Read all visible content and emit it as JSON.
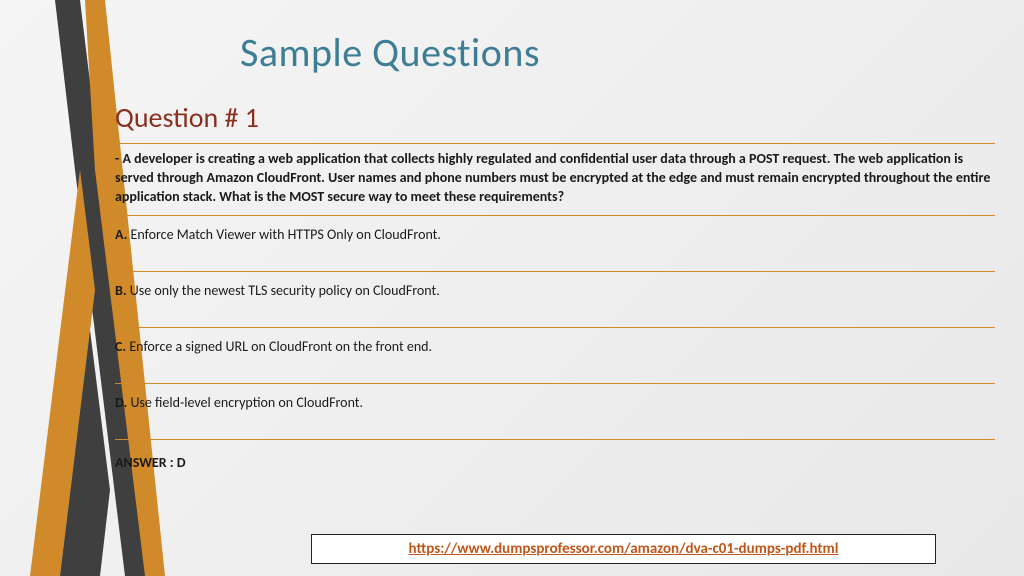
{
  "slide": {
    "title": "Sample Questions"
  },
  "question": {
    "heading": "Question # 1",
    "text": "- A developer is creating a web application that collects highly regulated and confidential user data through a POST request. The web application is served through Amazon CloudFront. User names and phone numbers must be encrypted at the edge and must remain encrypted throughout the entire application stack. What is the MOST secure way to meet these requirements?",
    "options": {
      "A": "Enforce Match Viewer with HTTPS Only on CloudFront.",
      "B": "Use only the newest TLS security policy on CloudFront.",
      "C": "Enforce a signed URL on CloudFront on the front end.",
      "D": "Use field-level encryption on CloudFront."
    },
    "answer_label": "ANSWER : D"
  },
  "footer": {
    "url": "https://www.dumpsprofessor.com/amazon/dva-c01-dumps-pdf.html"
  },
  "colors": {
    "accent_orange": "#d08a2a",
    "title_teal": "#3d7e95",
    "heading_maroon": "#8b2f1f",
    "link_orange": "#c1561a",
    "stripe_dark": "#3f3f3f"
  }
}
